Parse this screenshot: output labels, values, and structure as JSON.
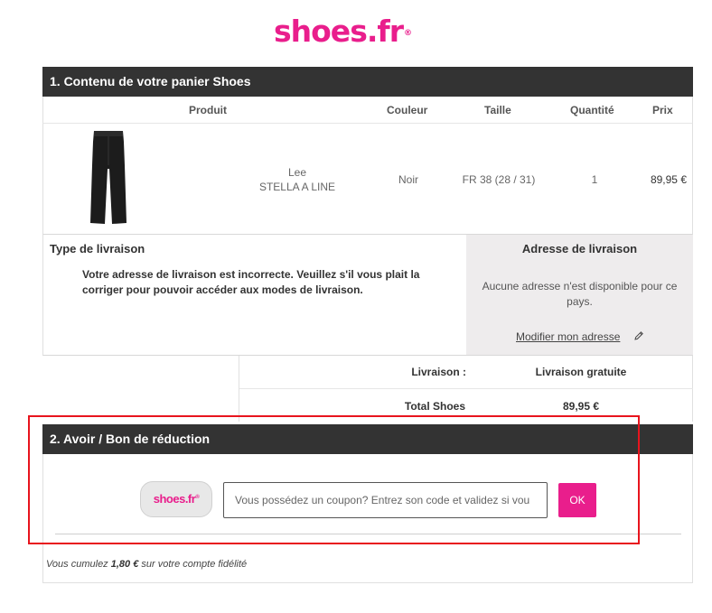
{
  "brand": {
    "logo_text": "shoes",
    "logo_dot_text": ".fr",
    "logo_mark": "®",
    "accent_color": "#e91e8c"
  },
  "section1": {
    "title": "1. Contenu de votre panier Shoes",
    "headers": {
      "product": "Produit",
      "color": "Couleur",
      "size": "Taille",
      "quantity": "Quantité",
      "price": "Prix"
    },
    "item": {
      "brand": "Lee",
      "name": "STELLA A LINE",
      "color": "Noir",
      "size": "FR 38 (28 / 31)",
      "quantity": "1",
      "price": "89,95 €",
      "image": "black-flared-pants"
    }
  },
  "delivery": {
    "type_title": "Type de livraison",
    "warning": "Votre adresse de livraison est incorrecte. Veuillez s'il vous plait la corriger pour pouvoir accéder aux modes de livraison.",
    "address_title": "Adresse de livraison",
    "address_message": "Aucune adresse n'est disponible pour ce pays.",
    "edit_link": "Modifier mon adresse"
  },
  "totals": {
    "delivery_label": "Livraison :",
    "delivery_value": "Livraison gratuite",
    "total_label": "Total Shoes",
    "total_value": "89,95 €"
  },
  "section2": {
    "title": "2. Avoir / Bon de réduction",
    "coupon_logo_text": "shoes.fr",
    "coupon_placeholder": "Vous possédez un coupon? Entrez son code et validez si vou",
    "ok_label": "OK",
    "fidelity_prefix": "Vous cumulez ",
    "fidelity_amount": "1,80 €",
    "fidelity_suffix": " sur votre compte fidélité"
  },
  "highlight_color": "#e8141d"
}
